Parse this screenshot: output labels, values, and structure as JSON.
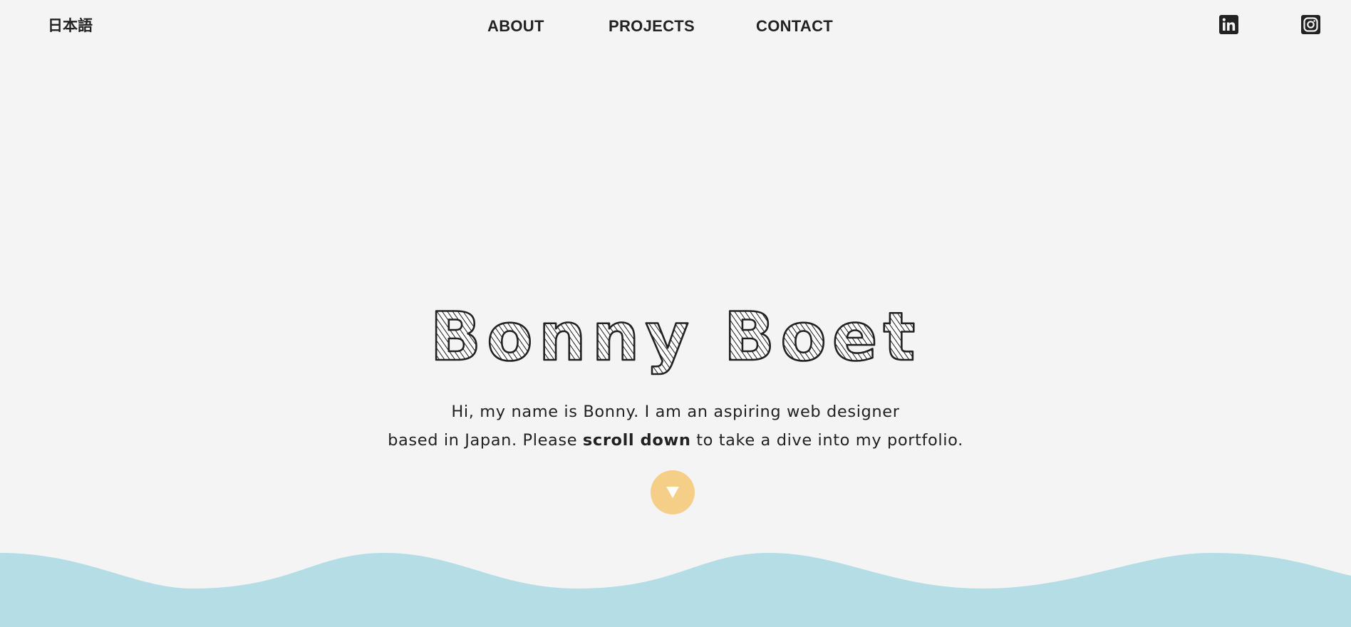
{
  "header": {
    "language_link": "日本語",
    "nav": {
      "about": "ABOUT",
      "projects": "PROJECTS",
      "contact": "CONTACT"
    },
    "social": {
      "linkedin_icon": "linkedin-icon",
      "instagram_icon": "instagram-icon"
    }
  },
  "hero": {
    "name": "Bonny Boet",
    "intro_line1": "Hi, my name is Bonny. I am an aspiring web designer",
    "intro_line2_before": "based in Japan. Please ",
    "intro_line2_bold": "scroll down",
    "intro_line2_after": " to take a dive into my portfolio.",
    "scroll_button_icon": "triangle-down-icon"
  },
  "colors": {
    "background": "#f3f4f3",
    "text": "#222222",
    "accent": "#f5cf87",
    "wave": "#b4dde6"
  }
}
